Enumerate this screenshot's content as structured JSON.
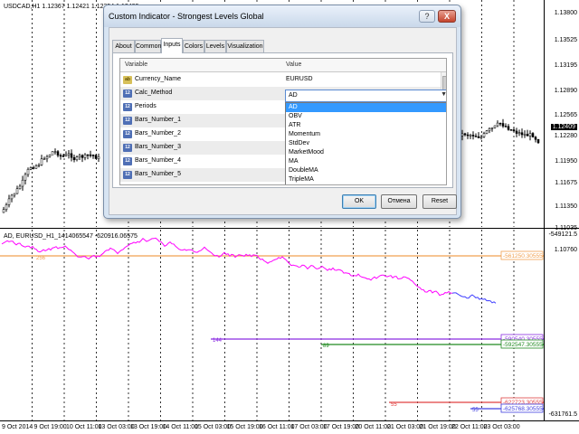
{
  "upper_chart": {
    "symbol_label": "USDCAD,H1  1.12367 1.12421 1.12354 1.12409",
    "price_labels": [
      "1.13800",
      "1.13525",
      "1.13195",
      "1.12890",
      "1.12565",
      "1.12409",
      "1.12280",
      "1.11950",
      "1.11675",
      "1.11350",
      "1.11035",
      "1.10760"
    ],
    "current_price": "1.12409"
  },
  "lower_chart": {
    "title": "AD, EURUSD_H1_1414065547 -620916.06575",
    "top_value": "-549121.5",
    "bottom_value": "-631761.5",
    "levels": [
      {
        "label": "-561250.30555",
        "color": "#f0a050"
      },
      {
        "label": "-590540.30555",
        "color": "#8a2be2"
      },
      {
        "label": "-592547.30555",
        "color": "#228b22"
      },
      {
        "label": "-622723.30555",
        "color": "#e04040"
      },
      {
        "label": "-625768.30555",
        "color": "#4040e0"
      }
    ],
    "level_tags": [
      "256",
      "144",
      "89",
      "55",
      "55"
    ]
  },
  "time_axis": {
    "labels": [
      "9 Oct 2014",
      "9 Oct 19:00",
      "10 Oct 11:00",
      "13 Oct 03:00",
      "13 Oct 19:00",
      "14 Oct 11:00",
      "15 Oct 03:00",
      "15 Oct 19:00",
      "16 Oct 11:00",
      "17 Oct 03:00",
      "17 Oct 19:00",
      "20 Oct 11:00",
      "21 Oct 03:00",
      "21 Oct 19:00",
      "22 Oct 11:00",
      "23 Oct 03:00"
    ]
  },
  "dialog": {
    "title": "Custom Indicator - Strongest Levels Global",
    "help_button": "?",
    "close_button": "X",
    "tabs": [
      "About",
      "Common",
      "Inputs",
      "Colors",
      "Levels",
      "Visualization"
    ],
    "active_tab": "Inputs",
    "columns": {
      "variable": "Variable",
      "value": "Value"
    },
    "rows": [
      {
        "icon": "ab",
        "name": "Currency_Name",
        "value": "EURUSD"
      },
      {
        "icon": "123",
        "name": "Calc_Method",
        "value": "AD"
      },
      {
        "icon": "123",
        "name": "Periods",
        "value": ""
      },
      {
        "icon": "123",
        "name": "Bars_Number_1",
        "value": ""
      },
      {
        "icon": "123",
        "name": "Bars_Number_2",
        "value": ""
      },
      {
        "icon": "123",
        "name": "Bars_Number_3",
        "value": ""
      },
      {
        "icon": "123",
        "name": "Bars_Number_4",
        "value": ""
      },
      {
        "icon": "123",
        "name": "Bars_Number_5",
        "value": ""
      }
    ],
    "combo_value": "AD",
    "dropdown_options": [
      "AD",
      "OBV",
      "ATR",
      "Momentum",
      "StdDev",
      "MarketMood",
      "MA",
      "DoubleMA",
      "TripleMA"
    ],
    "dropdown_selected": "AD",
    "buttons": {
      "ok": "OK",
      "cancel": "Отмена",
      "reset": "Reset"
    }
  },
  "colors": {
    "candle_up": "#000000",
    "indicator_line": "#ff00ff",
    "indicator_line_blue": "#4040ff",
    "dialog_select": "#3399ff"
  }
}
